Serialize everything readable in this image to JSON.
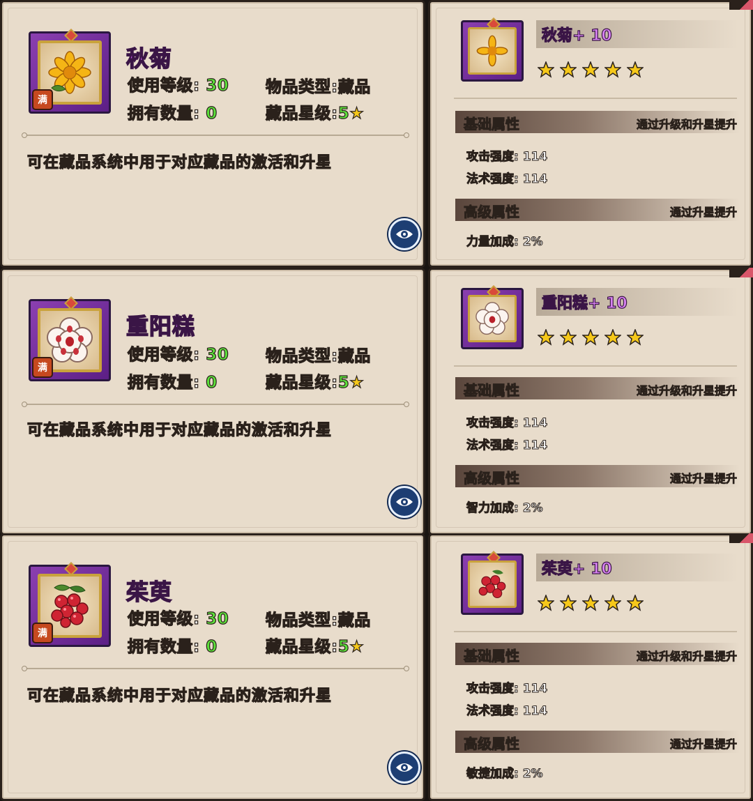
{
  "labels": {
    "use_level": "使用等级:",
    "owned": "拥有数量:",
    "item_type": "物品类型:",
    "collect_star": "藏品星级:",
    "full_badge": "满",
    "basic_attr": "基础属性",
    "basic_hint": "通过升级和升星提升",
    "adv_attr": "高级属性",
    "adv_hint": "通过升星提升"
  },
  "items": [
    {
      "name": "秋菊",
      "title": "秋菊+ 10",
      "use_level": "30",
      "owned": "0",
      "type": "藏品",
      "star": "5",
      "desc": "可在藏品系统中用于对应藏品的激活和升星",
      "attack": "攻击强度: 114",
      "magic": "法术强度: 114",
      "bonus": "力量加成: 2%",
      "stars": 5,
      "icon": "chrysanthemum-icon"
    },
    {
      "name": "重阳糕",
      "title": "重阳糕+ 10",
      "use_level": "30",
      "owned": "0",
      "type": "藏品",
      "star": "5",
      "desc": "可在藏品系统中用于对应藏品的激活和升星",
      "attack": "攻击强度: 114",
      "magic": "法术强度: 114",
      "bonus": "智力加成: 2%",
      "stars": 5,
      "icon": "double-ninth-cake-icon"
    },
    {
      "name": "茱萸",
      "title": "茱萸+ 10",
      "use_level": "30",
      "owned": "0",
      "type": "藏品",
      "star": "5",
      "desc": "可在藏品系统中用于对应藏品的激活和升星",
      "attack": "攻击强度: 114",
      "magic": "法术强度: 114",
      "bonus": "敏捷加成: 2%",
      "stars": 5,
      "icon": "dogwood-berry-icon"
    }
  ],
  "colors": {
    "name": "#c05ae6",
    "value": "#5ce03a",
    "frame": "#7a2fa3",
    "eye": "#1d3e73"
  }
}
